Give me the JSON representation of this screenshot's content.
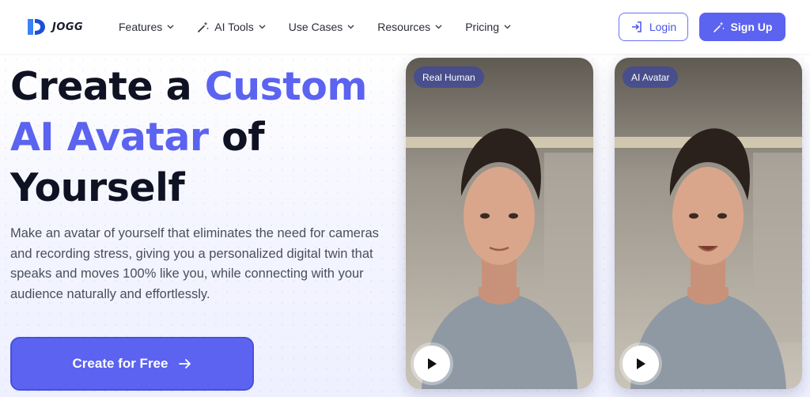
{
  "brand": {
    "name": "JOGG",
    "accent": "#5b63f0"
  },
  "nav": {
    "items": [
      {
        "label": "Features",
        "icon": "",
        "has_dropdown": true
      },
      {
        "label": "AI Tools",
        "icon": "magic-wand-icon",
        "has_dropdown": true
      },
      {
        "label": "Use Cases",
        "icon": "",
        "has_dropdown": true
      },
      {
        "label": "Resources",
        "icon": "",
        "has_dropdown": true
      },
      {
        "label": "Pricing",
        "icon": "",
        "has_dropdown": true
      }
    ],
    "login_label": "Login",
    "login_icon": "login-icon",
    "signup_label": "Sign Up",
    "signup_icon": "magic-wand-icon"
  },
  "hero": {
    "headline_part1": "Create a ",
    "headline_highlight1": "Custom",
    "headline_highlight2": "AI Avatar",
    "headline_part2": " of",
    "headline_part3": "Yourself",
    "description": "Make an avatar of yourself that eliminates the need for cameras and recording stress, giving you a personalized digital twin that speaks and moves 100% like you, while connecting with your audience naturally and effortlessly.",
    "cta_label": "Create for Free",
    "cta_icon": "arrow-right-icon"
  },
  "cards": [
    {
      "badge": "Real Human",
      "play_icon": "play-icon"
    },
    {
      "badge": "AI Avatar",
      "play_icon": "play-icon"
    }
  ]
}
